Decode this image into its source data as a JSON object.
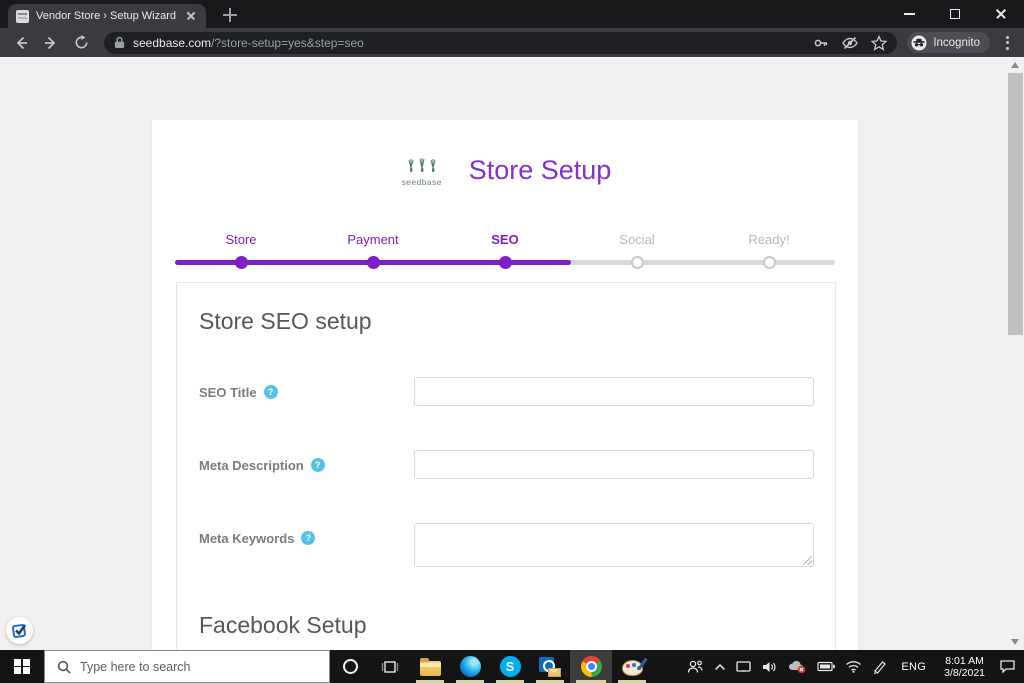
{
  "browser": {
    "tab": {
      "title": "Vendor Store › Setup Wizard"
    },
    "url": {
      "domain": "seedbase.com",
      "path": "/?store-setup=yes&step=seo"
    },
    "incognito_label": "Incognito"
  },
  "page": {
    "brand": {
      "logo_text": "seedbase"
    },
    "title": "Store Setup",
    "current_step": "SEO",
    "steps": [
      {
        "label": "Store",
        "state": "done"
      },
      {
        "label": "Payment",
        "state": "done"
      },
      {
        "label": "SEO",
        "state": "current"
      },
      {
        "label": "Social",
        "state": "upcoming"
      },
      {
        "label": "Ready!",
        "state": "upcoming"
      }
    ],
    "seo_section": {
      "heading": "Store SEO setup",
      "fields": [
        {
          "label": "SEO Title",
          "type": "input",
          "value": ""
        },
        {
          "label": "Meta Description",
          "type": "input",
          "value": ""
        },
        {
          "label": "Meta Keywords",
          "type": "textarea",
          "value": ""
        }
      ],
      "help_glyph": "?"
    },
    "facebook_section": {
      "heading": "Facebook Setup"
    }
  },
  "taskbar": {
    "search_placeholder": "Type here to search",
    "language": "ENG",
    "clock": {
      "time": "8:01 AM",
      "date": "3/8/2021"
    }
  },
  "colors": {
    "accent_purple": "#7d1fc9",
    "title_purple": "#8531d2",
    "help_blue": "#55c1e8",
    "step_inactive_gray": "#b9b9b9"
  }
}
